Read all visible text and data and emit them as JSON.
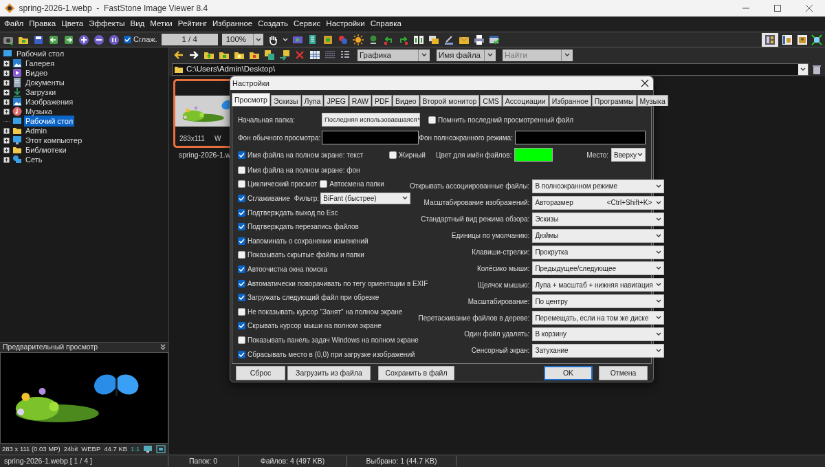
{
  "window": {
    "title": "spring-2026-1.webp  -  FastStone Image Viewer 8.4"
  },
  "menu": [
    "Файл",
    "Правка",
    "Цвета",
    "Эффекты",
    "Вид",
    "Метки",
    "Рейтинг",
    "Избранное",
    "Создать",
    "Сервис",
    "Настройки",
    "Справка"
  ],
  "toolbar": {
    "smoothing": {
      "label": "Сглаж.",
      "checked": true
    },
    "page": "1 / 4",
    "zoom": "100%"
  },
  "browser_bar": {
    "filter": "Графика",
    "sort": "Имя файла",
    "search": {
      "placeholder": "Найти"
    }
  },
  "path": "C:\\Users\\Admin\\Desktop\\",
  "tree": {
    "label": "Рабочий стол",
    "kind": "desktop",
    "selected": false,
    "children": [
      {
        "label": "Галерея",
        "kind": "gallery",
        "expandable": true,
        "selected": false
      },
      {
        "label": "Видео",
        "kind": "video",
        "expandable": true,
        "selected": false
      },
      {
        "label": "Документы",
        "kind": "documents",
        "expandable": true,
        "selected": false
      },
      {
        "label": "Загрузки",
        "kind": "downloads",
        "expandable": true,
        "selected": false
      },
      {
        "label": "Изображения",
        "kind": "gallery",
        "expandable": true,
        "selected": false
      },
      {
        "label": "Музыка",
        "kind": "music",
        "expandable": true,
        "selected": false
      },
      {
        "label": "Рабочий стол",
        "kind": "desktop",
        "expandable": false,
        "selected": true
      },
      {
        "label": "Admin",
        "kind": "folder",
        "expandable": true,
        "selected": false
      },
      {
        "label": "Этот компьютер",
        "kind": "computer",
        "expandable": true,
        "selected": false
      },
      {
        "label": "Библиотеки",
        "kind": "folder",
        "expandable": true,
        "selected": false
      },
      {
        "label": "Сеть",
        "kind": "network",
        "expandable": true,
        "selected": false
      }
    ]
  },
  "thumbnail": {
    "dims": "283x111",
    "format": "W",
    "filename": "spring-2026-1.w",
    "selected": true
  },
  "preview": {
    "title": "Предварительный просмотр",
    "info": [
      "283 x 111 (0.03 MP)",
      "24bit",
      "WEBP",
      "44.7 KB"
    ],
    "ratio": "1:1"
  },
  "status_bar": [
    "spring-2026-1.webp [ 1 / 4 ]",
    "Папок: 0",
    "Файлов: 4 (497 KB)",
    "Выбрано: 1 (44.7 KB)"
  ],
  "dialog": {
    "title": "Настройки",
    "tabs": [
      {
        "label": "Просмотр",
        "selected": true
      },
      {
        "label": "Эскизы",
        "selected": false
      },
      {
        "label": "Лупа",
        "selected": false
      },
      {
        "label": "JPEG",
        "selected": false
      },
      {
        "label": "RAW",
        "selected": false
      },
      {
        "label": "PDF",
        "selected": false
      },
      {
        "label": "Видео",
        "selected": false
      },
      {
        "label": "Второй монитор",
        "selected": false
      },
      {
        "label": "CMS",
        "selected": false
      },
      {
        "label": "Ассоциации",
        "selected": false
      },
      {
        "label": "Избранное",
        "selected": false
      },
      {
        "label": "Программы",
        "selected": false
      },
      {
        "label": "Музыка",
        "selected": false
      }
    ],
    "start_folder": {
      "label": "Начальная папка:",
      "value": "Последняя использовавшаяся"
    },
    "remember_last": {
      "label": "Помнить последний просмотренный файл",
      "checked": false
    },
    "normal_bg": {
      "label": "Фон обычного просмотра:",
      "color": "#000000"
    },
    "fullscreen_bg": {
      "label": "Фон полноэкранного режима:",
      "color": "#000000"
    },
    "filename_text": {
      "label": "Имя файла на полном экране: текст",
      "checked": true
    },
    "bold": {
      "label": "Жирный",
      "checked": false
    },
    "filename_color": {
      "label": "Цвет для имён файлов:",
      "color": "#00ff00"
    },
    "position": {
      "label": "Место:",
      "value": "Вверху"
    },
    "options": [
      {
        "kind": "check",
        "label": "Имя файла на полном экране: фон",
        "checked": false
      },
      {
        "kind": "pair",
        "items": [
          {
            "label": "Циклический просмот",
            "checked": false
          },
          {
            "label": "Автосмена папки",
            "checked": false
          }
        ]
      },
      {
        "kind": "filter",
        "label": "Сглаживание",
        "checked": true,
        "filter_label": "Фильтр:",
        "filter_value": "BiFant (быстрее)"
      },
      {
        "kind": "check",
        "label": "Подтверждать выход по Esc",
        "checked": true
      },
      {
        "kind": "check",
        "label": "Подтверждать перезапись файлов",
        "checked": true
      },
      {
        "kind": "check",
        "label": "Напоминать о сохранении изменений",
        "checked": true
      },
      {
        "kind": "check",
        "label": "Показывать скрытые файлы и папки",
        "checked": false
      },
      {
        "kind": "check",
        "label": "Автоочистка окна поиска",
        "checked": true
      },
      {
        "kind": "check",
        "label": "Автоматически поворачивать по тегу ориентации в EXIF",
        "checked": true
      },
      {
        "kind": "check",
        "label": "Загружать следующий файл при обрезке",
        "checked": true
      },
      {
        "kind": "check",
        "label": "Не показывать курсор \"Занят\" на полном экране",
        "checked": false
      },
      {
        "kind": "check",
        "label": "Скрывать курсор мыши на полном экране",
        "checked": true
      },
      {
        "kind": "check",
        "label": "Показывать панель задач Windows на полном экране",
        "checked": false
      },
      {
        "kind": "check",
        "label": "Сбрасывать место в (0,0) при загрузке изображений",
        "checked": true
      }
    ],
    "settings": [
      {
        "label": "Открывать ассоциированные файлы:",
        "value": "В полноэкранном режиме"
      },
      {
        "label": "Масштабирование изображений:",
        "value": "Авторазмер",
        "shortcut": "<Ctrl+Shift+K>"
      },
      {
        "label": "Стандартный вид режима обзора:",
        "value": "Эскизы"
      },
      {
        "label": "Единицы по умолчанию:",
        "value": "Дюймы"
      },
      {
        "label": "Клавиши-стрелки:",
        "value": "Прокрутка"
      },
      {
        "label": "Колёсико мыши:",
        "value": "Предыдущее/следующее"
      },
      {
        "label": "Щелчок мышью:",
        "value": "Лупа + масштаб + нижняя навигация"
      },
      {
        "label": "Масштабирование:",
        "value": "По центру"
      },
      {
        "label": "Перетаскивание файлов в дереве:",
        "value": "Перемещать, если на том же диске"
      },
      {
        "label": "Один файл удалять:",
        "value": "В корзину"
      },
      {
        "label": "Сенсорный экран:",
        "value": "Затухание"
      }
    ],
    "buttons": [
      {
        "label": "Сброс",
        "default": false
      },
      {
        "label": "Загрузить из файла",
        "default": false
      },
      {
        "label": "Сохранить в файл",
        "default": false
      },
      {
        "label": "OK",
        "default": true
      },
      {
        "label": "Отмена",
        "default": false
      }
    ]
  }
}
